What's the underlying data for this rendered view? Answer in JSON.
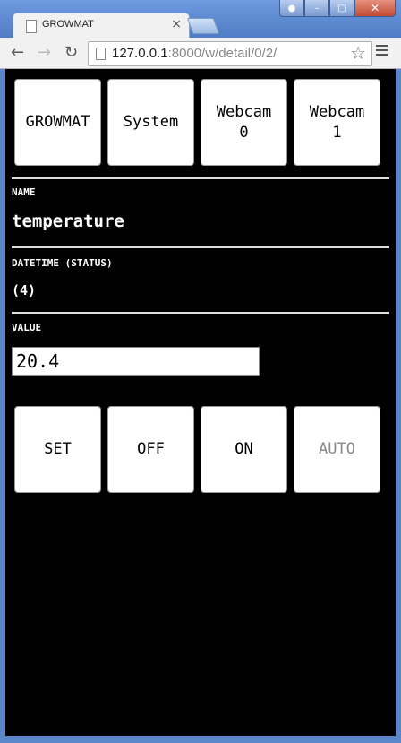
{
  "browser": {
    "tab_title": "GROWMAT",
    "url_host": "127.0.0.1",
    "url_rest": ":8000/w/detail/0/2/",
    "close_glyph": "×",
    "icons": {
      "back": "back-arrow-icon",
      "forward": "forward-arrow-icon",
      "reload": "reload-icon",
      "star": "bookmark-star-icon",
      "menu": "hamburger-menu-icon"
    }
  },
  "nav_buttons": [
    {
      "label": "GROWMAT"
    },
    {
      "label": "System"
    },
    {
      "label": "Webcam\n0"
    },
    {
      "label": "Webcam\n1"
    }
  ],
  "fields": {
    "name_label": "NAME",
    "name_value": "temperature",
    "datetime_label": "DATETIME (STATUS)",
    "datetime_value": "(4)",
    "value_label": "VALUE",
    "value_input": "20.4"
  },
  "actions": [
    {
      "label": "SET",
      "enabled": true
    },
    {
      "label": "OFF",
      "enabled": true
    },
    {
      "label": "ON",
      "enabled": true
    },
    {
      "label": "AUTO",
      "enabled": false
    }
  ],
  "colors": {
    "page_bg": "#000000",
    "button_bg": "#ffffff",
    "disabled_text": "#888888",
    "window_frame": "#5b86c9"
  }
}
